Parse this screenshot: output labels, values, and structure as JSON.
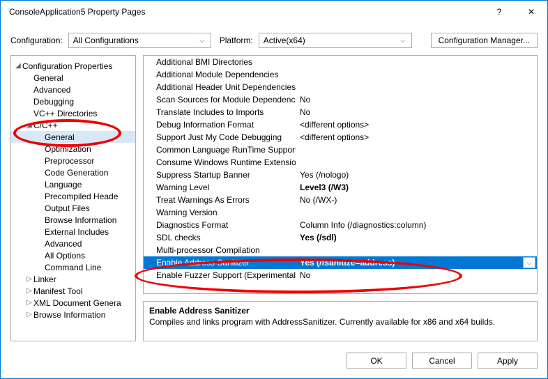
{
  "window_title": "ConsoleApplication5 Property Pages",
  "config_label": "Configuration:",
  "config_value": "All Configurations",
  "platform_label": "Platform:",
  "platform_value": "Active(x64)",
  "config_mgr_label": "Configuration Manager...",
  "tree": {
    "root": "Configuration Properties",
    "items_lvl1": [
      {
        "label": "General",
        "expandable": false
      },
      {
        "label": "Advanced",
        "expandable": false
      },
      {
        "label": "Debugging",
        "expandable": false
      },
      {
        "label": "VC++ Directories",
        "expandable": false
      },
      {
        "label": "C/C++",
        "expandable": true,
        "expanded": true,
        "children": [
          "General",
          "Optimization",
          "Preprocessor",
          "Code Generation",
          "Language",
          "Precompiled Heade",
          "Output Files",
          "Browse Information",
          "External Includes",
          "Advanced",
          "All Options",
          "Command Line"
        ],
        "selected_child": 0
      },
      {
        "label": "Linker",
        "expandable": true,
        "expanded": false
      },
      {
        "label": "Manifest Tool",
        "expandable": true,
        "expanded": false
      },
      {
        "label": "XML Document Genera",
        "expandable": true,
        "expanded": false
      },
      {
        "label": "Browse Information",
        "expandable": true,
        "expanded": false
      }
    ]
  },
  "properties": [
    {
      "name": "Additional BMI Directories",
      "value": ""
    },
    {
      "name": "Additional Module Dependencies",
      "value": ""
    },
    {
      "name": "Additional Header Unit Dependencies",
      "value": ""
    },
    {
      "name": "Scan Sources for Module Dependencies",
      "value": "No"
    },
    {
      "name": "Translate Includes to Imports",
      "value": "No"
    },
    {
      "name": "Debug Information Format",
      "value": "<different options>"
    },
    {
      "name": "Support Just My Code Debugging",
      "value": "<different options>"
    },
    {
      "name": "Common Language RunTime Support",
      "value": ""
    },
    {
      "name": "Consume Windows Runtime Extension",
      "value": ""
    },
    {
      "name": "Suppress Startup Banner",
      "value": "Yes (/nologo)"
    },
    {
      "name": "Warning Level",
      "value": "Level3 (/W3)",
      "bold": true
    },
    {
      "name": "Treat Warnings As Errors",
      "value": "No (/WX-)"
    },
    {
      "name": "Warning Version",
      "value": ""
    },
    {
      "name": "Diagnostics Format",
      "value": "Column Info (/diagnostics:column)"
    },
    {
      "name": "SDL checks",
      "value": "Yes (/sdl)",
      "bold": true
    },
    {
      "name": "Multi-processor Compilation",
      "value": ""
    },
    {
      "name": "Enable Address Sanitizer",
      "value": "Yes (/fsanitize=address)",
      "bold": true,
      "selected": true
    },
    {
      "name": "Enable Fuzzer Support (Experimental)",
      "value": "No"
    }
  ],
  "description": {
    "title": "Enable Address Sanitizer",
    "text": "Compiles and links program with AddressSanitizer. Currently available for x86 and x64 builds."
  },
  "buttons": {
    "ok": "OK",
    "cancel": "Cancel",
    "apply": "Apply"
  }
}
